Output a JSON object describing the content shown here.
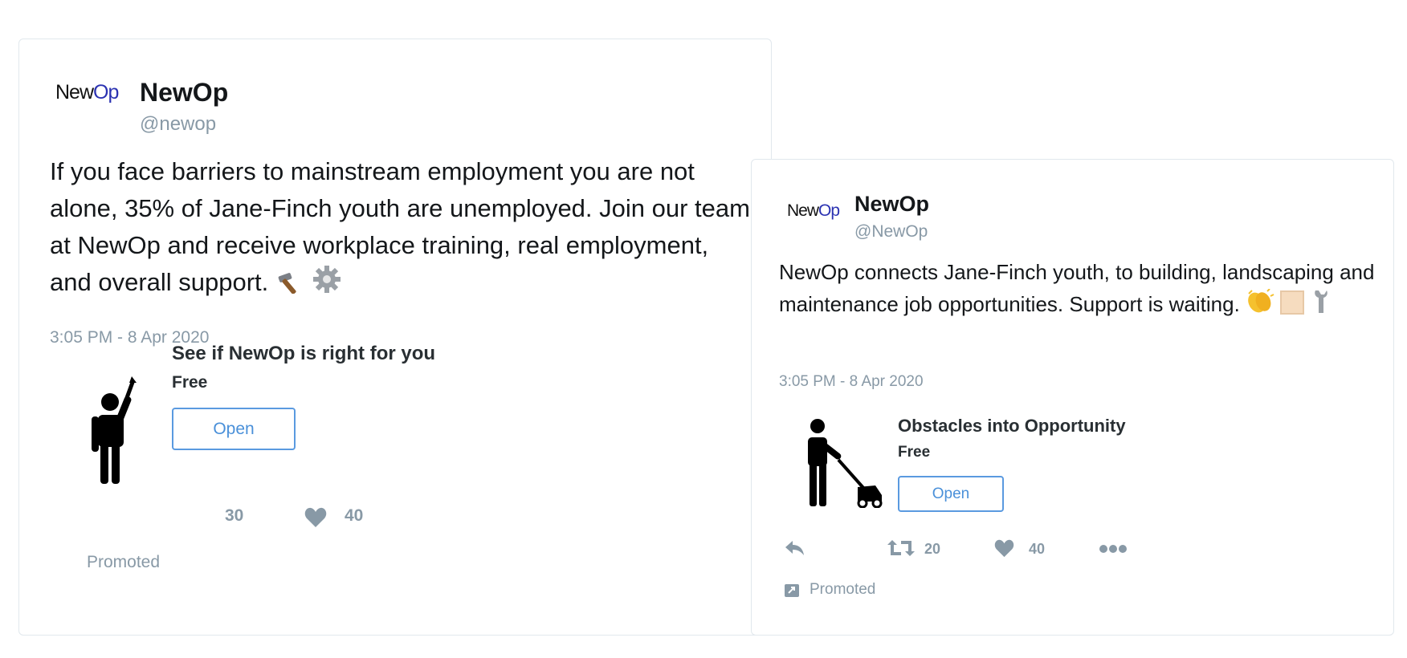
{
  "tweets": [
    {
      "logo": {
        "part1": "New",
        "part2": "Op"
      },
      "name": "NewOp",
      "handle": "@newop",
      "text": "If you face barriers to mainstream employment you are not alone, 35% of Jane-Finch youth are unemployed. Join our team at NewOp and receive workplace training, real employment, and overall support.",
      "emojis": [
        "hammer-icon",
        "gear-icon"
      ],
      "timestamp": "3:05 PM - 8 Apr 2020",
      "app_card": {
        "icon": "person-raising-tool-icon",
        "title": "See if NewOp is right for you",
        "price": "Free",
        "button": "Open"
      },
      "actions": {
        "retweets": "30",
        "likes": "40"
      },
      "promoted": "Promoted"
    },
    {
      "logo": {
        "part1": "New",
        "part2": "Op"
      },
      "name": "NewOp",
      "handle": "@NewOp",
      "text": "NewOp connects Jane-Finch youth, to building, landscaping and maintenance job opportunities. Support is waiting.",
      "emojis": [
        "clapping-hands-icon",
        "skin-tone-swatch-icon",
        "wrench-icon"
      ],
      "timestamp": "3:05 PM - 8 Apr 2020",
      "app_card": {
        "icon": "person-mowing-lawn-icon",
        "title": "Obstacles into Opportunity",
        "price": "Free",
        "button": "Open"
      },
      "actions": {
        "retweets": "20",
        "likes": "40"
      },
      "promoted": "Promoted"
    }
  ],
  "colors": {
    "link_blue": "#5a9ae0",
    "muted": "#8899a6",
    "logo_op": "#2b32b2"
  }
}
